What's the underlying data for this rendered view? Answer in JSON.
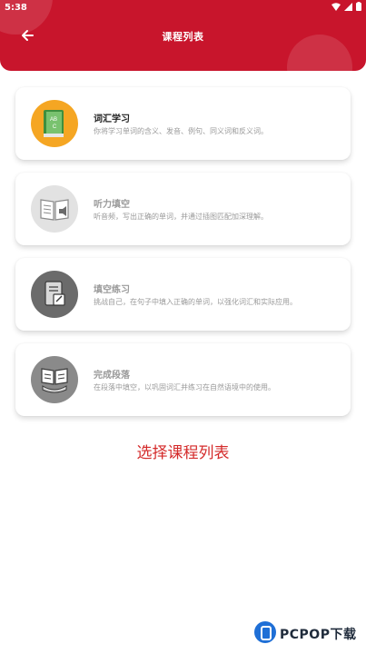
{
  "status_bar": {
    "time": "5:38"
  },
  "header": {
    "title": "课程列表"
  },
  "courses": [
    {
      "title": "词汇学习",
      "desc": "你将学习单词的含义、发音、例句、同义词和反义词。",
      "icon": "vocabulary-book-icon",
      "icon_bg": "#f5a623"
    },
    {
      "title": "听力填空",
      "desc": "听音频，写出正确的单词，并通过插图匹配加深理解。",
      "icon": "listening-book-icon",
      "icon_bg": "#e2e2e2"
    },
    {
      "title": "填空练习",
      "desc": "挑战自己，在句子中填入正确的单词，以强化词汇和实际应用。",
      "icon": "fill-blank-icon",
      "icon_bg": "#6b6b6b"
    },
    {
      "title": "完成段落",
      "desc": "在段落中填空，以巩固词汇并练习在自然语境中的使用。",
      "icon": "open-book-hand-icon",
      "icon_bg": "#8a8a8a"
    }
  ],
  "prompt": "选择课程列表",
  "watermark": {
    "brand": "PCPOP下载"
  },
  "colors": {
    "primary": "#c8152c",
    "prompt": "#d42a2a"
  }
}
